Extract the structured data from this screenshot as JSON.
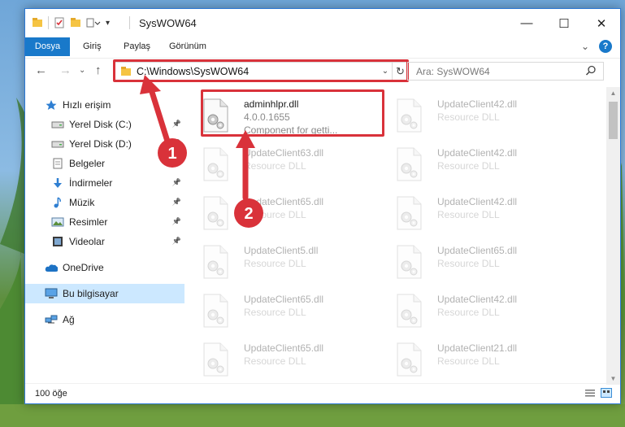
{
  "window": {
    "title": "SysWOW64",
    "controls": {
      "minimize": "—",
      "maximize": "☐",
      "close": "✕"
    }
  },
  "ribbon": {
    "tabs": [
      "Dosya",
      "Giriş",
      "Paylaş",
      "Görünüm"
    ],
    "collapse": "⌄",
    "help": "?"
  },
  "nav": {
    "back": "←",
    "forward": "→",
    "recent": "⌄",
    "up": "↑",
    "address": "C:\\Windows\\SysWOW64",
    "address_dropdown": "⌄",
    "refresh": "↻",
    "search_placeholder": "Ara: SysWOW64",
    "search_icon": "search-icon"
  },
  "sidebar": {
    "items": [
      {
        "label": "Hızlı erişim",
        "icon": "star-icon",
        "pinned": false
      },
      {
        "label": "Yerel Disk (C:)",
        "icon": "drive-icon",
        "pinned": true
      },
      {
        "label": "Yerel Disk (D:)",
        "icon": "drive-icon",
        "pinned": true
      },
      {
        "label": "Belgeler",
        "icon": "documents-icon",
        "pinned": true
      },
      {
        "label": "İndirmeler",
        "icon": "download-icon",
        "pinned": true
      },
      {
        "label": "Müzik",
        "icon": "music-icon",
        "pinned": true
      },
      {
        "label": "Resimler",
        "icon": "pictures-icon",
        "pinned": true
      },
      {
        "label": "Videolar",
        "icon": "video-icon",
        "pinned": true
      },
      {
        "label": "OneDrive",
        "icon": "cloud-icon",
        "pinned": false
      },
      {
        "label": "Bu bilgisayar",
        "icon": "computer-icon",
        "pinned": false,
        "selected": true
      },
      {
        "label": "Ağ",
        "icon": "network-icon",
        "pinned": false
      }
    ]
  },
  "files": [
    {
      "name": "adminhlpr.dll",
      "line1": "4.0.0.1655",
      "line2": "Component for getti...",
      "highlighted": true
    },
    {
      "name": "UpdateClient42.dll",
      "line1": "Resource DLL",
      "line2": ""
    },
    {
      "name": "UpdateClient63.dll",
      "line1": "Resource DLL",
      "line2": ""
    },
    {
      "name": "UpdateClient42.dll",
      "line1": "Resource DLL",
      "line2": ""
    },
    {
      "name": "UpdateClient65.dll",
      "line1": "Resource DLL",
      "line2": ""
    },
    {
      "name": "UpdateClient42.dll",
      "line1": "Resource DLL",
      "line2": ""
    },
    {
      "name": "UpdateClient5.dll",
      "line1": "Resource DLL",
      "line2": ""
    },
    {
      "name": "UpdateClient65.dll",
      "line1": "Resource DLL",
      "line2": ""
    },
    {
      "name": "UpdateClient65.dll",
      "line1": "Resource DLL",
      "line2": ""
    },
    {
      "name": "UpdateClient42.dll",
      "line1": "Resource DLL",
      "line2": ""
    },
    {
      "name": "UpdateClient65.dll",
      "line1": "Resource DLL",
      "line2": ""
    },
    {
      "name": "UpdateClient21.dll",
      "line1": "Resource DLL",
      "line2": ""
    }
  ],
  "status": {
    "count": "100 öğe"
  },
  "annotations": {
    "step1": "1",
    "step2": "2",
    "color": "#d9323a"
  }
}
